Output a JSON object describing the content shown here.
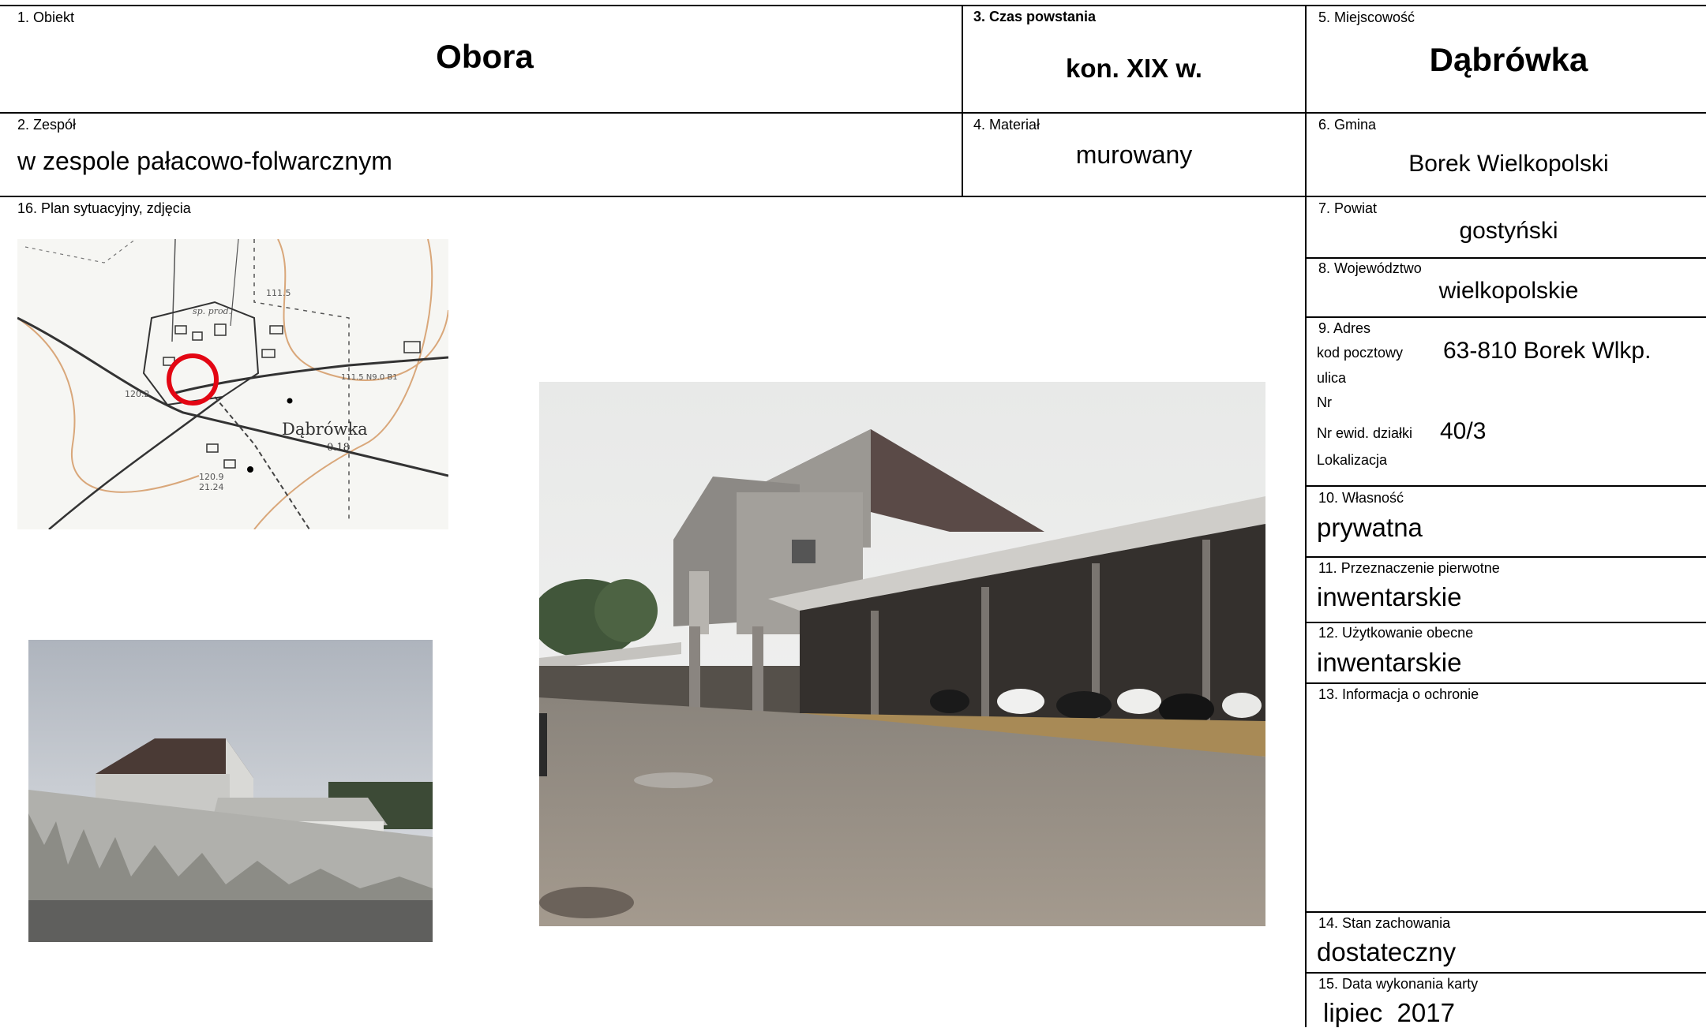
{
  "card": {
    "obiekt": {
      "label": "1. Obiekt",
      "value": "Obora"
    },
    "czas": {
      "label": "3. Czas powstania",
      "value": "kon. XIX w."
    },
    "miejscowosc": {
      "label": "5. Miejscowość",
      "value": "Dąbrówka"
    },
    "zespol": {
      "label": "2. Zespół",
      "value": "w zespole pałacowo-folwarcznym"
    },
    "material": {
      "label": "4. Materiał",
      "value": "murowany"
    },
    "gmina": {
      "label": "6. Gmina",
      "value": "Borek Wielkopolski"
    },
    "plan": {
      "label": "16. Plan sytuacyjny, zdjęcia"
    },
    "powiat": {
      "label": "7. Powiat",
      "value": "gostyński"
    },
    "wojewodztwo": {
      "label": "8. Województwo",
      "value": "wielkopolskie"
    },
    "adres": {
      "label": "9. Adres",
      "kod_label": "kod pocztowy",
      "kod_value": "63-810 Borek Wlkp.",
      "ulica_label": "ulica",
      "nr_label": "Nr",
      "dzialka_label": "Nr ewid. działki",
      "dzialka_value": "40/3",
      "lokalizacja_label": "Lokalizacja"
    },
    "wlasnosc": {
      "label": "10. Własność",
      "value": "prywatna"
    },
    "przeznaczenie": {
      "label": "11. Przeznaczenie pierwotne",
      "value": "inwentarskie"
    },
    "uzytkowanie": {
      "label": "12. Użytkowanie obecne",
      "value": "inwentarskie"
    },
    "ochrona": {
      "label": "13. Informacja o ochronie"
    },
    "stan": {
      "label": "14. Stan zachowania",
      "value": "dostateczny"
    },
    "data": {
      "label": "15. Data wykonania karty",
      "value": "lipiec  2017"
    }
  },
  "map": {
    "place": "Dąbrówka",
    "place_num": "0.18",
    "spot_1": "120.2",
    "spot_2": "120.9",
    "spot_3": "21.24",
    "spot_4": "111.5",
    "road_label": "111.5 N9.0 B1",
    "park_label": "sp. prod.",
    "marker_color": "#e30613"
  }
}
